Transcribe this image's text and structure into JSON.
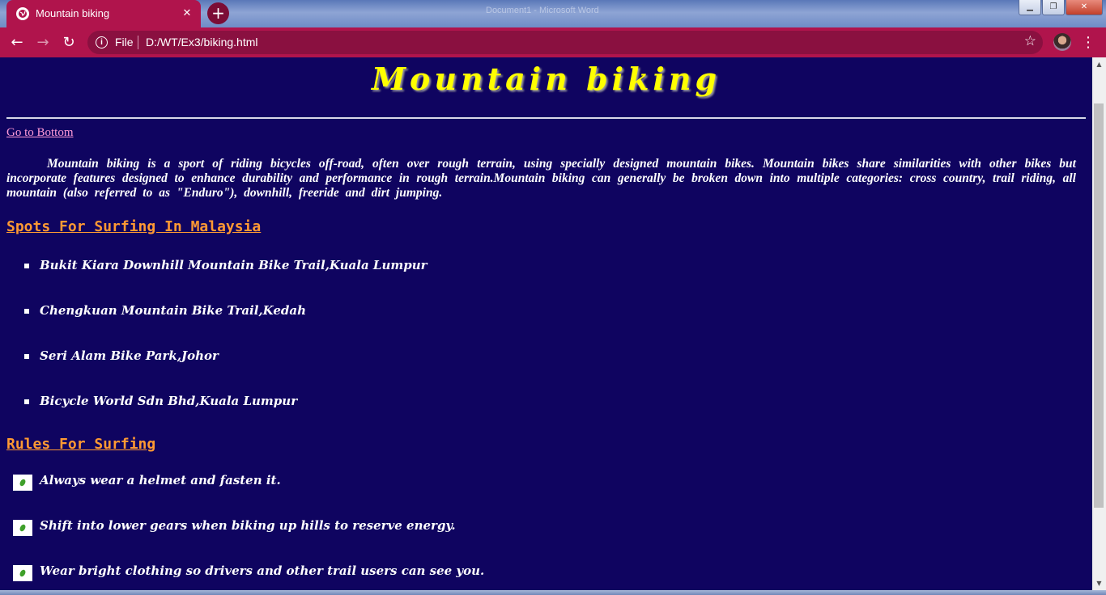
{
  "window": {
    "title": "Document1 - Microsoft Word"
  },
  "tab": {
    "title": "Mountain biking",
    "close": "✕"
  },
  "toolbar": {
    "scheme": "File",
    "url": "D:/WT/Ex3/biking.html"
  },
  "page": {
    "heading": "Mountain biking",
    "goto_link": "Go to Bottom",
    "intro": "Mountain biking is a sport of riding bicycles off-road, often over rough terrain, using specially designed mountain bikes. Mountain bikes share similarities with other bikes but incorporate features designed to enhance durability and performance in rough terrain.Mountain biking can generally be broken down into multiple categories: cross country, trail riding, all mountain (also referred to as \"Enduro\"), downhill, freeride and dirt jumping.",
    "spots_heading": "Spots For Surfing In Malaysia",
    "spots": [
      "Bukit Kiara Downhill Mountain Bike Trail,Kuala Lumpur",
      "Chengkuan Mountain Bike Trail,Kedah",
      "Seri Alam Bike Park,Johor",
      "Bicycle World Sdn Bhd,Kuala Lumpur"
    ],
    "rules_heading": "Rules For Surfing",
    "rules": [
      "Always wear a helmet and fasten it.",
      "Shift into lower gears when biking up hills to reserve energy.",
      "Wear bright clothing so drivers and other trail users can see you."
    ]
  },
  "colors": {
    "page_bg": "#0f0460",
    "heading": "#ffff00",
    "link": "#ff9bd7",
    "section_heading": "#ff9933",
    "chrome": "#b0144c"
  },
  "icons": {
    "tab_favicon": "globe-icon",
    "rule_bullet": "leaf-icon",
    "spot_bullet": "square-bullet"
  }
}
